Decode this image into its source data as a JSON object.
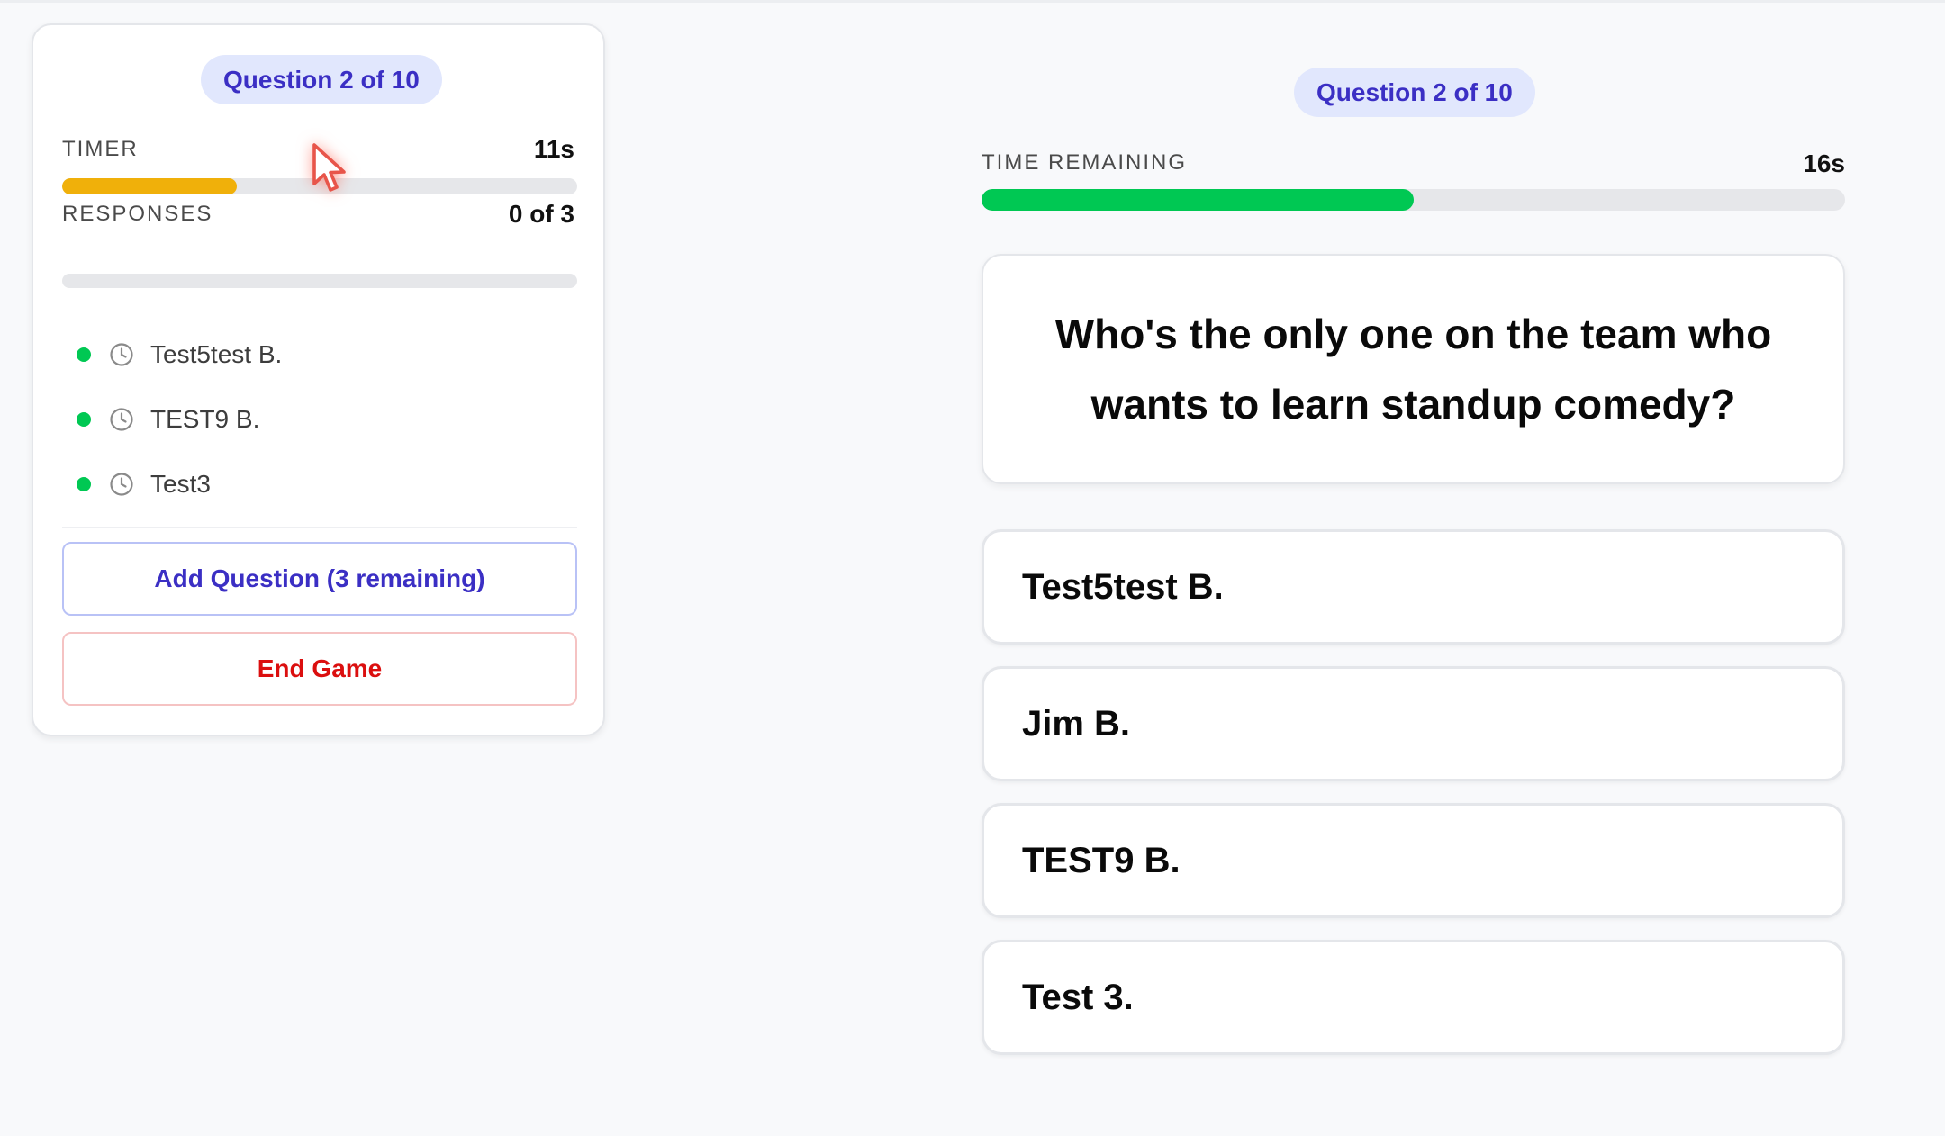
{
  "host_panel": {
    "badge": "Question 2 of 10",
    "timer": {
      "label": "TIMER",
      "value": "11s",
      "progress_percent": 34,
      "color": "#f0b00a"
    },
    "responses": {
      "label": "RESPONSES",
      "value": "0 of 3",
      "progress_percent": 0,
      "color": "#00c853"
    },
    "players": [
      {
        "name": "Test5test B.",
        "status_color": "#00c853",
        "icon": "clock-icon"
      },
      {
        "name": "TEST9 B.",
        "status_color": "#00c853",
        "icon": "clock-icon"
      },
      {
        "name": "Test3",
        "status_color": "#00c853",
        "icon": "clock-icon"
      }
    ],
    "add_question_label": "Add Question (3 remaining)",
    "end_game_label": "End Game"
  },
  "player_view": {
    "badge": "Question 2 of 10",
    "time_remaining": {
      "label": "TIME REMAINING",
      "value": "16s",
      "progress_percent": 50,
      "color": "#00c853"
    },
    "question": "Who's the only one on the team who wants to learn standup comedy?",
    "answers": [
      "Test5test B.",
      "Jim B.",
      "TEST9 B.",
      "Test 3."
    ]
  },
  "colors": {
    "accent": "#3b2fc4",
    "badge_bg": "#e1e7fd",
    "danger": "#db0f0f",
    "success": "#00c853",
    "warning": "#f0b00a"
  }
}
